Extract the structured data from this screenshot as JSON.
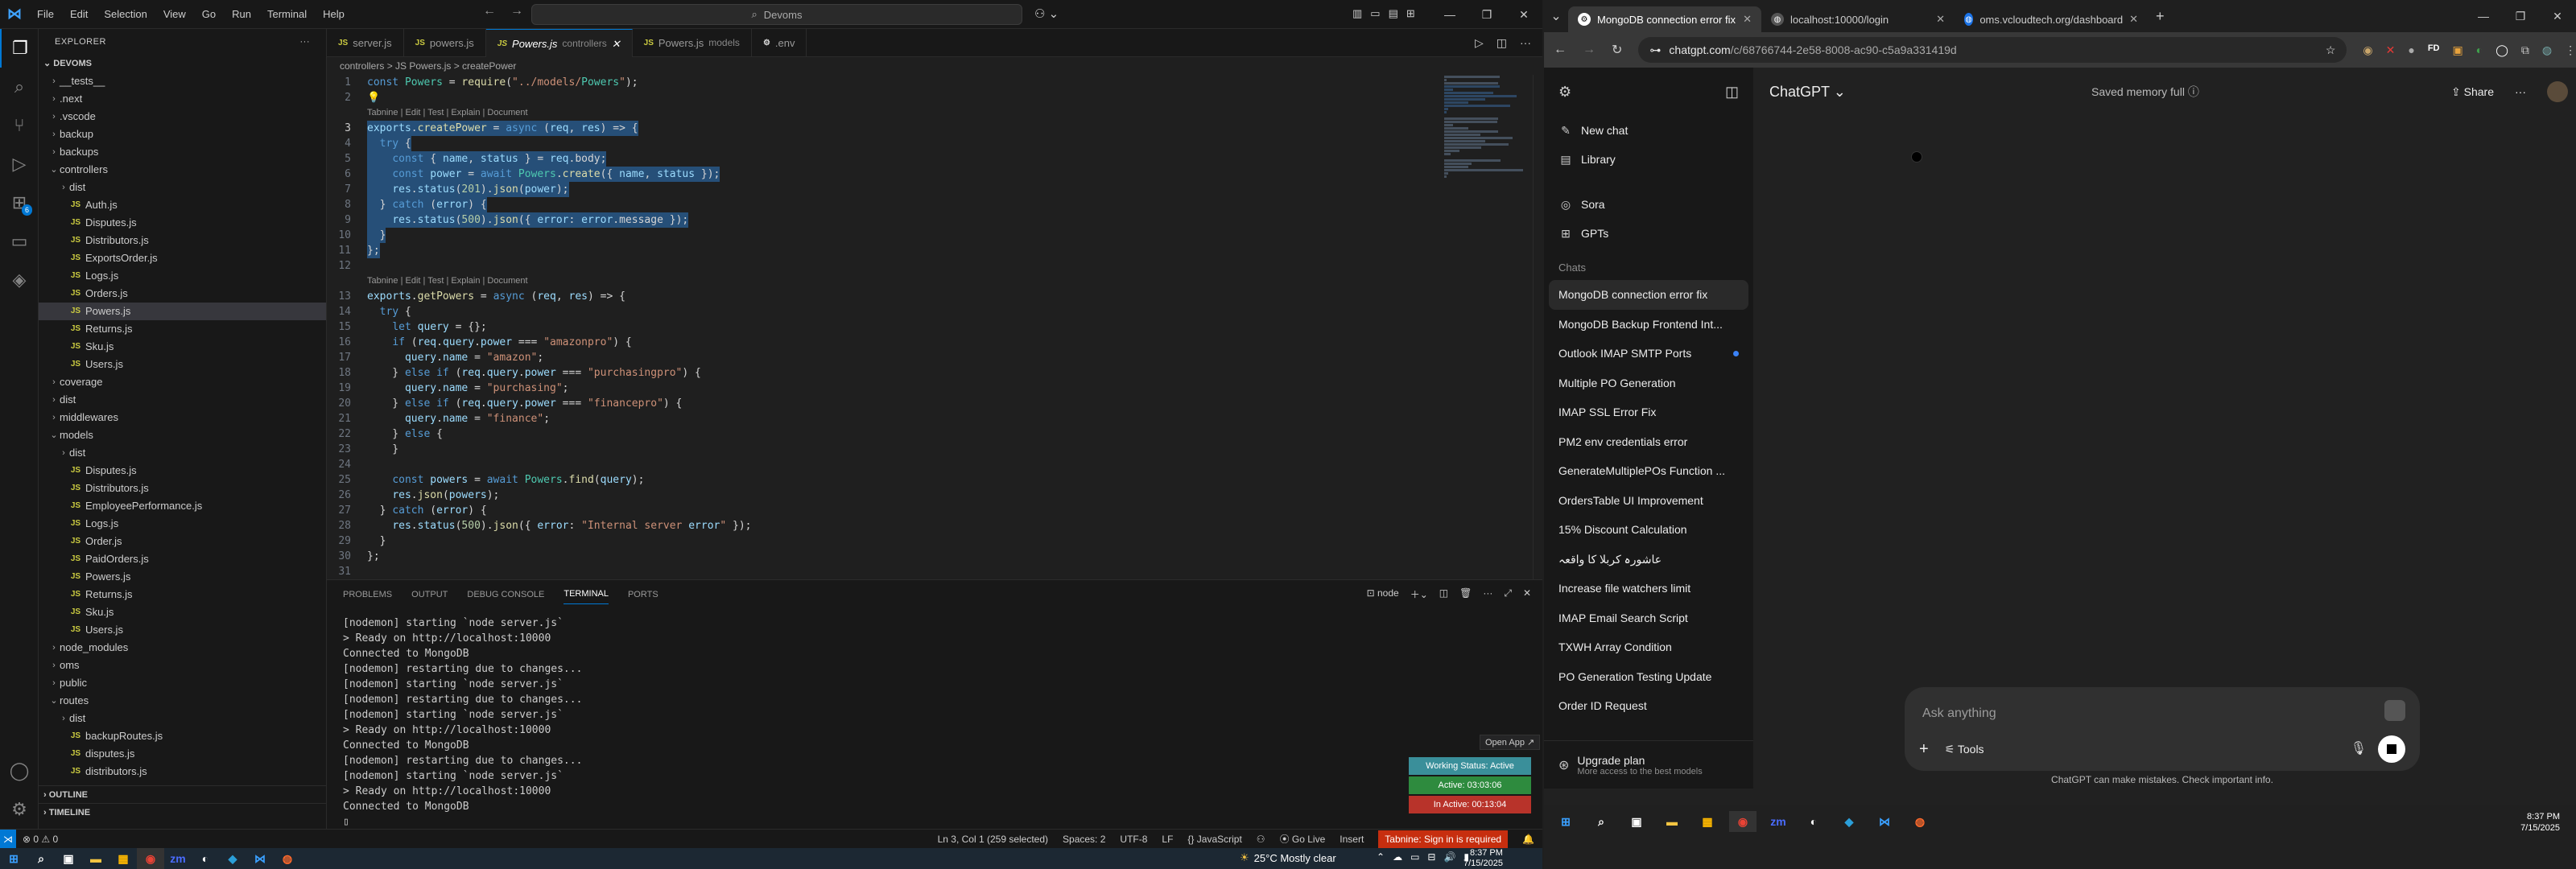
{
  "vscode": {
    "menu": [
      "File",
      "Edit",
      "Selection",
      "View",
      "Go",
      "Run",
      "Terminal",
      "Help"
    ],
    "search_text": "Devoms",
    "explorer": {
      "title": "EXPLORER",
      "root": "DEVOMS",
      "items": [
        {
          "label": "__tests__",
          "kind": "folder",
          "depth": 1
        },
        {
          "label": ".next",
          "kind": "folder",
          "depth": 1
        },
        {
          "label": ".vscode",
          "kind": "folder",
          "depth": 1
        },
        {
          "label": "backup",
          "kind": "folder",
          "depth": 1
        },
        {
          "label": "backups",
          "kind": "folder",
          "depth": 1
        },
        {
          "label": "controllers",
          "kind": "folder-open",
          "depth": 1
        },
        {
          "label": "dist",
          "kind": "folder",
          "depth": 2
        },
        {
          "label": "Auth.js",
          "kind": "js",
          "depth": 2
        },
        {
          "label": "Disputes.js",
          "kind": "js",
          "depth": 2
        },
        {
          "label": "Distributors.js",
          "kind": "js",
          "depth": 2
        },
        {
          "label": "ExportsOrder.js",
          "kind": "js",
          "depth": 2
        },
        {
          "label": "Logs.js",
          "kind": "js",
          "depth": 2
        },
        {
          "label": "Orders.js",
          "kind": "js",
          "depth": 2
        },
        {
          "label": "Powers.js",
          "kind": "js",
          "depth": 2,
          "selected": true
        },
        {
          "label": "Returns.js",
          "kind": "js",
          "depth": 2
        },
        {
          "label": "Sku.js",
          "kind": "js",
          "depth": 2
        },
        {
          "label": "Users.js",
          "kind": "js",
          "depth": 2
        },
        {
          "label": "coverage",
          "kind": "folder",
          "depth": 1
        },
        {
          "label": "dist",
          "kind": "folder",
          "depth": 1
        },
        {
          "label": "middlewares",
          "kind": "folder",
          "depth": 1
        },
        {
          "label": "models",
          "kind": "folder-open",
          "depth": 1
        },
        {
          "label": "dist",
          "kind": "folder",
          "depth": 2
        },
        {
          "label": "Disputes.js",
          "kind": "js",
          "depth": 2
        },
        {
          "label": "Distributors.js",
          "kind": "js",
          "depth": 2
        },
        {
          "label": "EmployeePerformance.js",
          "kind": "js",
          "depth": 2
        },
        {
          "label": "Logs.js",
          "kind": "js",
          "depth": 2
        },
        {
          "label": "Order.js",
          "kind": "js",
          "depth": 2
        },
        {
          "label": "PaidOrders.js",
          "kind": "js",
          "depth": 2
        },
        {
          "label": "Powers.js",
          "kind": "js",
          "depth": 2
        },
        {
          "label": "Returns.js",
          "kind": "js",
          "depth": 2
        },
        {
          "label": "Sku.js",
          "kind": "js",
          "depth": 2
        },
        {
          "label": "Users.js",
          "kind": "js",
          "depth": 2
        },
        {
          "label": "node_modules",
          "kind": "folder",
          "depth": 1
        },
        {
          "label": "oms",
          "kind": "folder",
          "depth": 1
        },
        {
          "label": "public",
          "kind": "folder",
          "depth": 1
        },
        {
          "label": "routes",
          "kind": "folder-open",
          "depth": 1
        },
        {
          "label": "dist",
          "kind": "folder",
          "depth": 2
        },
        {
          "label": "backupRoutes.js",
          "kind": "js",
          "depth": 2
        },
        {
          "label": "disputes.js",
          "kind": "js",
          "depth": 2
        },
        {
          "label": "distributors.js",
          "kind": "js",
          "depth": 2
        }
      ],
      "outline": "OUTLINE",
      "timeline": "TIMELINE"
    },
    "tabs": [
      {
        "label": "server.js",
        "desc": "",
        "icon": "JS"
      },
      {
        "label": "powers.js",
        "desc": "",
        "icon": "JS"
      },
      {
        "label": "Powers.js",
        "desc": "controllers",
        "icon": "JS",
        "active": true
      },
      {
        "label": "Powers.js",
        "desc": "models",
        "icon": "JS"
      },
      {
        "label": ".env",
        "desc": "",
        "icon": "env"
      }
    ],
    "breadcrumb": "controllers  >  JS Powers.js  >  createPower",
    "code": [
      {
        "n": "1",
        "t": "const Powers = require(\"../models/Powers\");"
      },
      {
        "n": "2",
        "t": "💡"
      },
      {
        "lens": "Tabnine | Edit | Test | Explain | Document"
      },
      {
        "n": "3",
        "t": "exports.createPower = async (req, res) => {",
        "sel": true
      },
      {
        "n": "4",
        "t": "  try {",
        "sel": true
      },
      {
        "n": "5",
        "t": "    const { name, status } = req.body;",
        "sel": true
      },
      {
        "n": "6",
        "t": "    const power = await Powers.create({ name, status });",
        "sel": true
      },
      {
        "n": "7",
        "t": "    res.status(201).json(power);",
        "sel": true
      },
      {
        "n": "8",
        "t": "  } catch (error) {",
        "sel": true
      },
      {
        "n": "9",
        "t": "    res.status(500).json({ error: error.message });",
        "sel": true
      },
      {
        "n": "10",
        "t": "  }",
        "sel": true
      },
      {
        "n": "11",
        "t": "};",
        "sel": true
      },
      {
        "n": "12",
        "t": ""
      },
      {
        "lens": "Tabnine | Edit | Test | Explain | Document"
      },
      {
        "n": "13",
        "t": "exports.getPowers = async (req, res) => {"
      },
      {
        "n": "14",
        "t": "  try {"
      },
      {
        "n": "15",
        "t": "    let query = {};"
      },
      {
        "n": "16",
        "t": "    if (req.query.power === \"amazonpro\") {"
      },
      {
        "n": "17",
        "t": "      query.name = \"amazon\";"
      },
      {
        "n": "18",
        "t": "    } else if (req.query.power === \"purchasingpro\") {"
      },
      {
        "n": "19",
        "t": "      query.name = \"purchasing\";"
      },
      {
        "n": "20",
        "t": "    } else if (req.query.power === \"financepro\") {"
      },
      {
        "n": "21",
        "t": "      query.name = \"finance\";"
      },
      {
        "n": "22",
        "t": "    } else {"
      },
      {
        "n": "23",
        "t": "    }"
      },
      {
        "n": "24",
        "t": ""
      },
      {
        "n": "25",
        "t": "    const powers = await Powers.find(query);"
      },
      {
        "n": "26",
        "t": "    res.json(powers);"
      },
      {
        "n": "27",
        "t": "  } catch (error) {"
      },
      {
        "n": "28",
        "t": "    res.status(500).json({ error: \"Internal server error\" });"
      },
      {
        "n": "29",
        "t": "  }"
      },
      {
        "n": "30",
        "t": "};"
      },
      {
        "n": "31",
        "t": ""
      }
    ],
    "panel_tabs": [
      "PROBLEMS",
      "OUTPUT",
      "DEBUG CONSOLE",
      "TERMINAL",
      "PORTS"
    ],
    "panel_active": "TERMINAL",
    "terminal_name": "node",
    "terminal": [
      {
        "t": "[nodemon] starting `node server.js`",
        "c": "g"
      },
      {
        "t": "> Ready on http://localhost:10000",
        "c": ""
      },
      {
        "t": "Connected to MongoDB",
        "c": ""
      },
      {
        "t": "[nodemon] restarting due to changes...",
        "c": "g"
      },
      {
        "t": "[nodemon] starting `node server.js`",
        "c": "g"
      },
      {
        "t": "[nodemon] restarting due to changes...",
        "c": "g"
      },
      {
        "t": "[nodemon] starting `node server.js`",
        "c": "g"
      },
      {
        "t": "> Ready on http://localhost:10000",
        "c": ""
      },
      {
        "t": "Connected to MongoDB",
        "c": ""
      },
      {
        "t": "[nodemon] restarting due to changes...",
        "c": "g"
      },
      {
        "t": "[nodemon] starting `node server.js`",
        "c": "g"
      },
      {
        "t": "> Ready on http://localhost:10000",
        "c": ""
      },
      {
        "t": "Connected to MongoDB",
        "c": ""
      }
    ],
    "open_app": "Open App ↗",
    "work_status": [
      {
        "label": "Working Status: Active",
        "color": "#3a8f9a"
      },
      {
        "label": "Active: 03:03:06",
        "color": "#2e8b3e"
      },
      {
        "label": "In Active: 00:13:04",
        "color": "#b8332a"
      }
    ],
    "status": {
      "left": "⊗ 0 ⚠ 0",
      "pos": "Ln 3, Col 1 (259 selected)",
      "spaces": "Spaces: 2",
      "enc": "UTF-8",
      "eol": "LF",
      "lang": "{} JavaScript",
      "golive": "⦿ Go Live",
      "insert": "Insert",
      "tabnine": "Tabnine: Sign in is required"
    },
    "taskbar": {
      "weather": "25°C  Mostly clear",
      "time": "8:37 PM",
      "date": "7/15/2025"
    }
  },
  "chrome": {
    "tabs": [
      {
        "label": "MongoDB connection error fix",
        "active": true
      },
      {
        "label": "localhost:10000/login",
        "active": false
      },
      {
        "label": "oms.vcloudtech.org/dashboard",
        "active": false
      }
    ],
    "url_host": "chatgpt.com",
    "url_path": "/c/68766744-2e58-8008-ac90-c5a9a331419d"
  },
  "chatgpt": {
    "nav": [
      {
        "label": "New chat",
        "icon": "edit-icon"
      },
      {
        "label": "Library",
        "icon": "library-icon"
      },
      {
        "label": "Sora",
        "icon": "sora-icon"
      },
      {
        "label": "GPTs",
        "icon": "gpts-icon"
      }
    ],
    "chats_heading": "Chats",
    "chats": [
      {
        "label": "MongoDB connection error fix",
        "active": true
      },
      {
        "label": "MongoDB Backup Frontend Int..."
      },
      {
        "label": "Outlook IMAP SMTP Ports",
        "dot": true
      },
      {
        "label": "Multiple PO Generation"
      },
      {
        "label": "IMAP SSL Error Fix"
      },
      {
        "label": "PM2 env credentials error"
      },
      {
        "label": "GenerateMultiplePOs Function ..."
      },
      {
        "label": "OrdersTable UI Improvement"
      },
      {
        "label": "15% Discount Calculation"
      },
      {
        "label": "عاشورہ کربلا کا واقعہ"
      },
      {
        "label": "Increase file watchers limit"
      },
      {
        "label": "IMAP Email Search Script"
      },
      {
        "label": "TXWH Array Condition"
      },
      {
        "label": "PO Generation Testing Update"
      },
      {
        "label": "Order ID Request"
      }
    ],
    "upgrade_title": "Upgrade plan",
    "upgrade_sub": "More access to the best models",
    "model": "ChatGPT ⌄",
    "memory": "Saved memory full ⓘ",
    "share": "Share",
    "placeholder": "Ask anything",
    "tools": "Tools",
    "disclaimer": "ChatGPT can make mistakes. Check important info.",
    "time": "8:37 PM",
    "date": "7/15/2025"
  }
}
